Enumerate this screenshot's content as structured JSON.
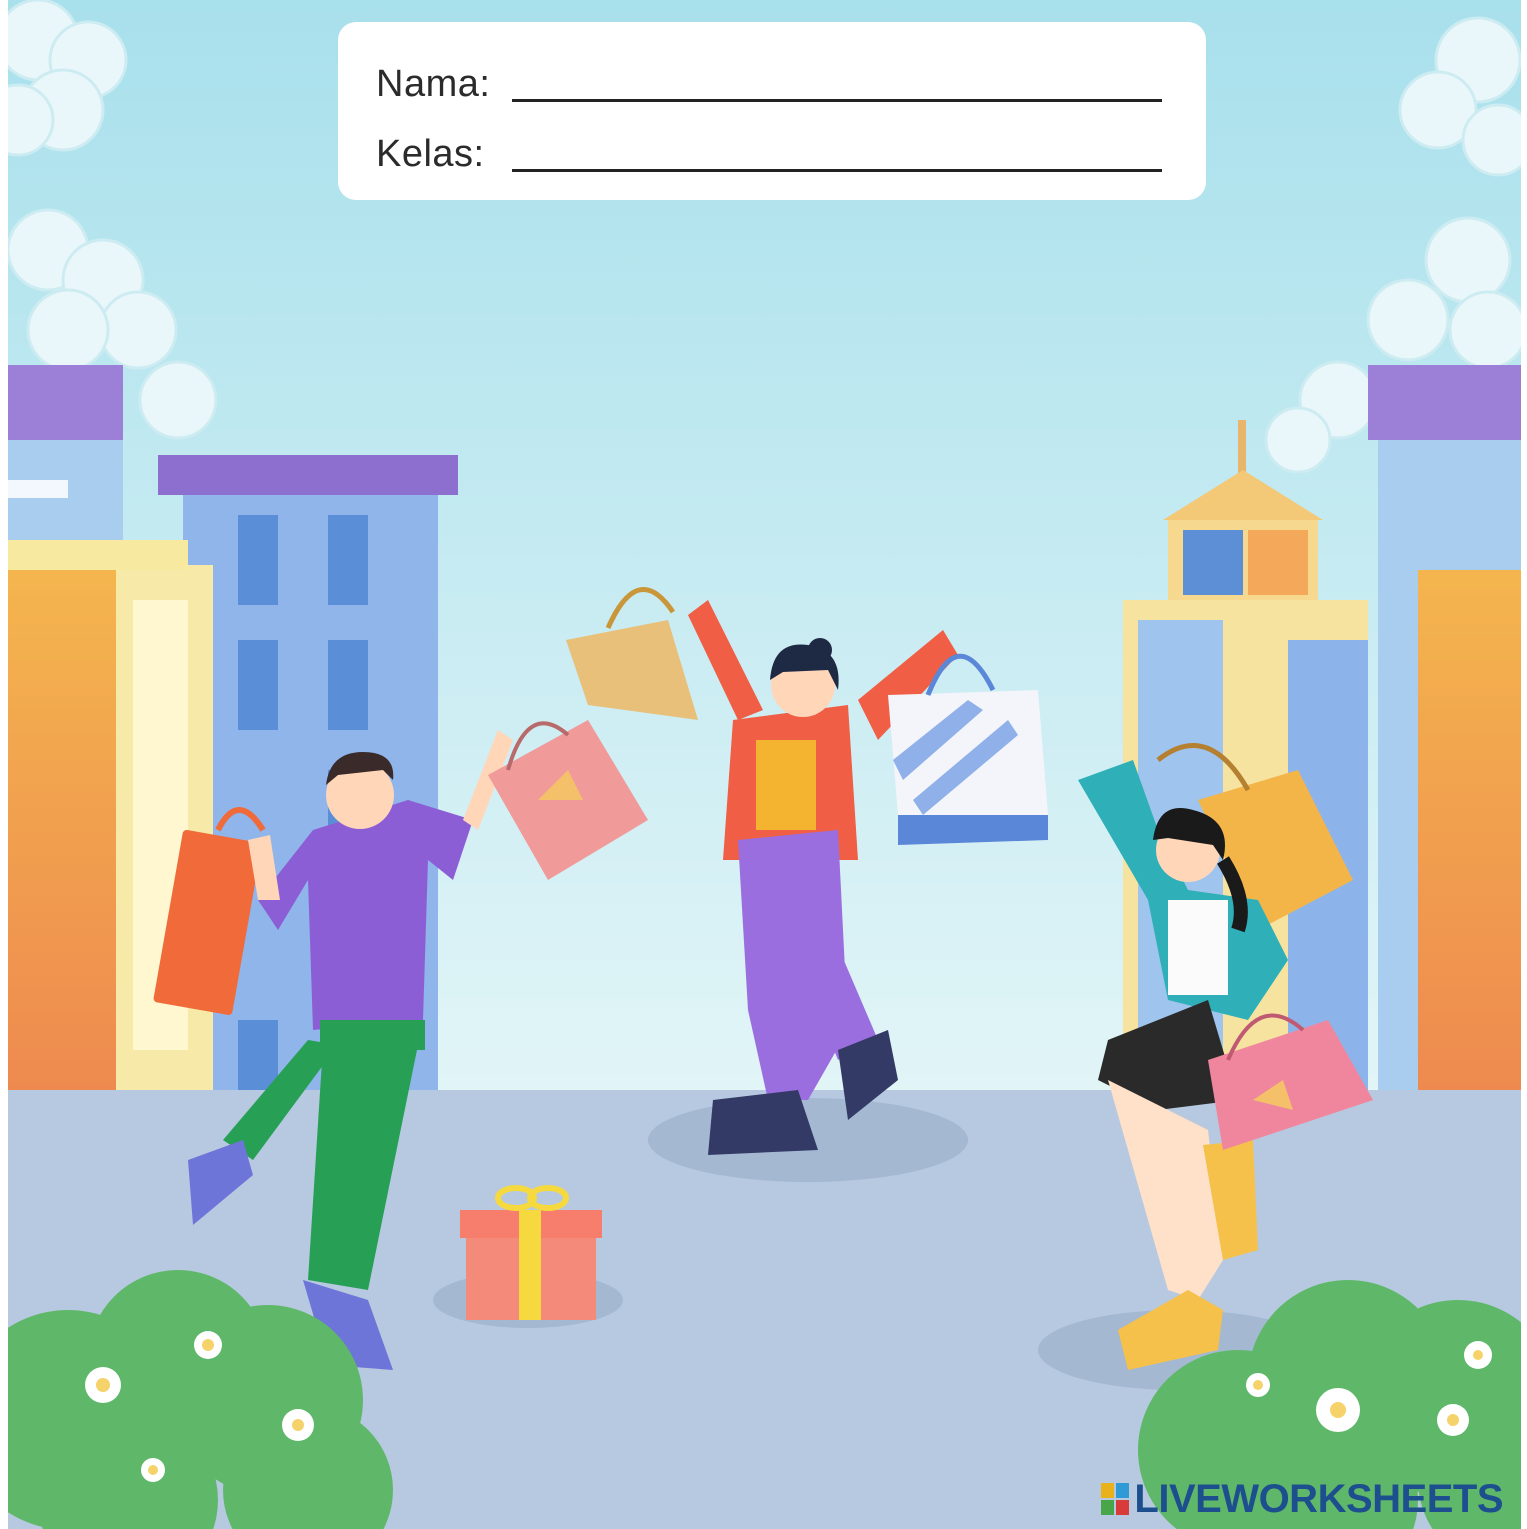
{
  "form": {
    "name_label": "Nama:",
    "class_label": "Kelas:"
  },
  "watermark": {
    "text": "LIVEWORKSHEETS",
    "icon": "liveworksheets-logo-icon"
  },
  "colors": {
    "sky_top": "#a8e0ec",
    "sky_bottom": "#e2f5f7",
    "ground": "#b7c9e0",
    "bush": "#5fb86a",
    "watermark": "#1d4f8f"
  }
}
